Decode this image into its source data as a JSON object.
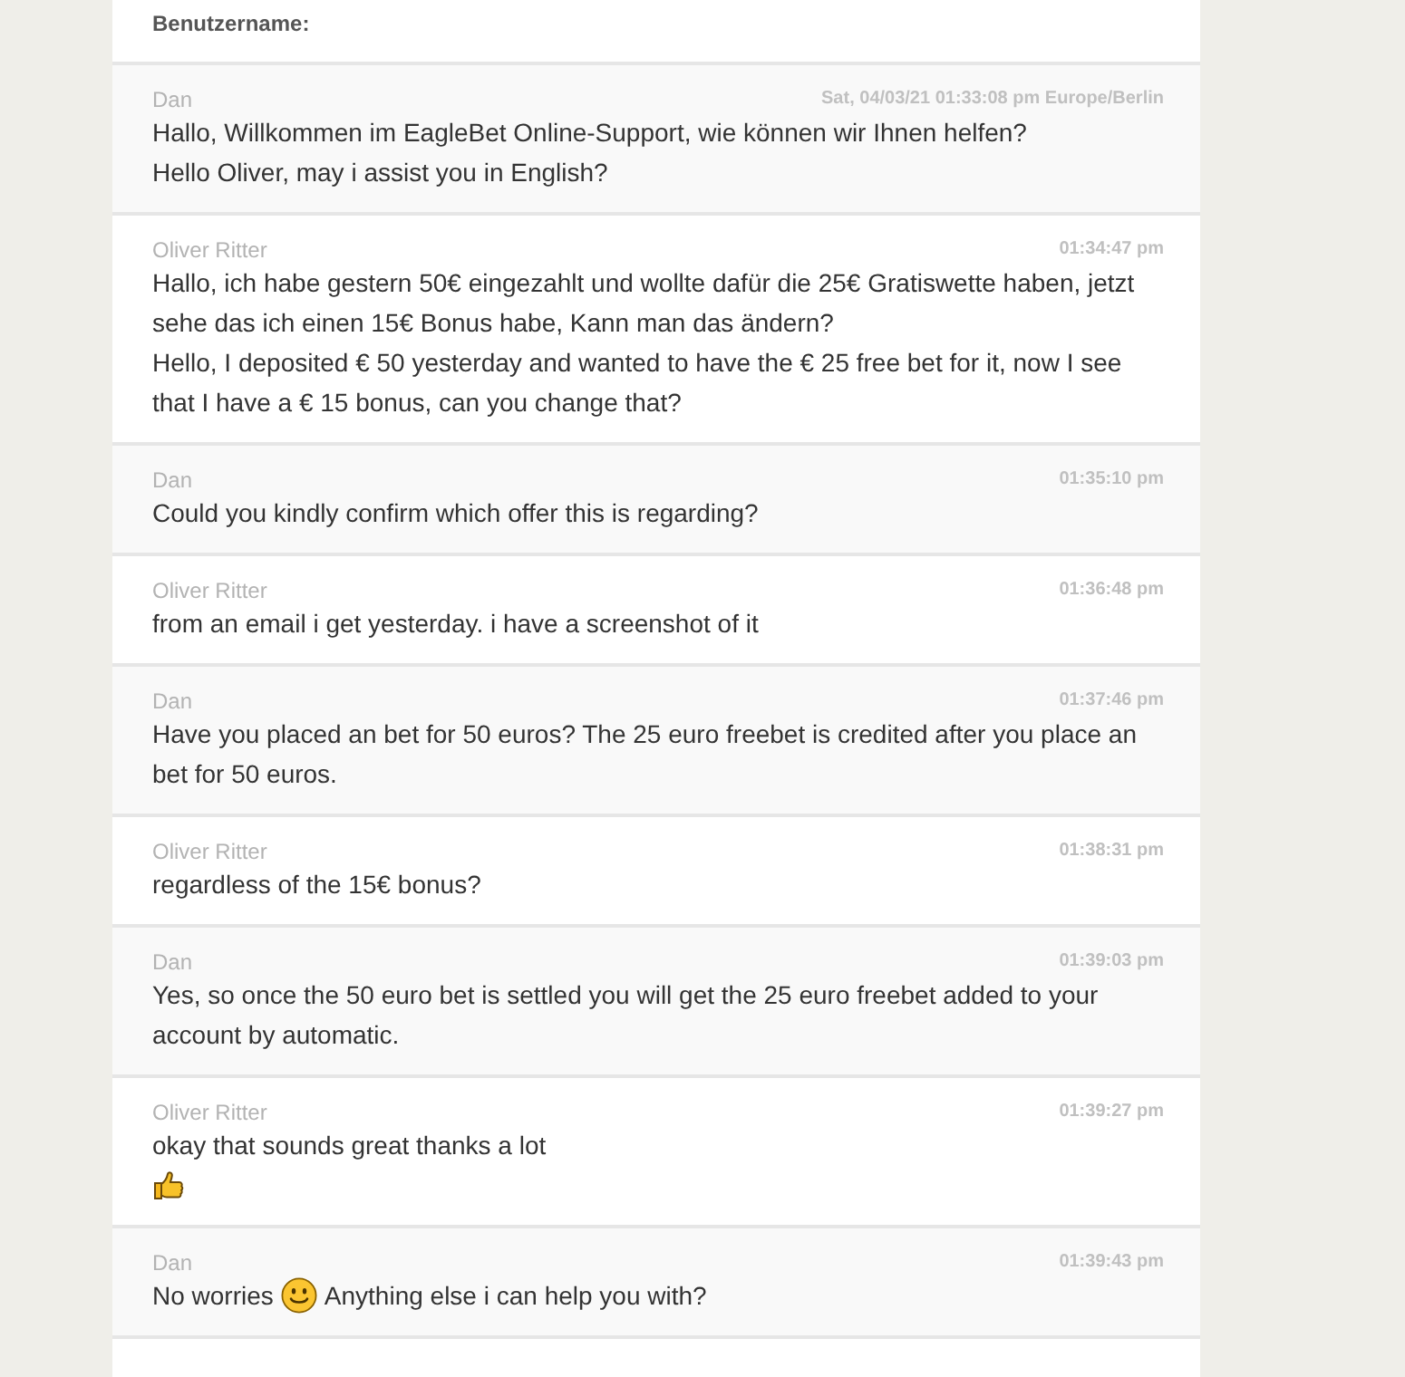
{
  "top_section": {
    "label": "Benutzername:"
  },
  "messages": [
    {
      "kind": "agent",
      "sender": "Dan",
      "time": "Sat, 04/03/21 01:33:08 pm Europe/Berlin",
      "paragraphs": [
        [
          {
            "kind": "text",
            "text": "Hallo, Willkommen im EagleBet Online-Support, wie können wir Ihnen helfen?"
          }
        ],
        [
          {
            "kind": "text",
            "text": "Hello Oliver, may i assist you in English?"
          }
        ]
      ]
    },
    {
      "kind": "customer",
      "sender": "Oliver Ritter",
      "time": "01:34:47 pm",
      "paragraphs": [
        [
          {
            "kind": "text",
            "text": "Hallo, ich habe gestern 50€ eingezahlt und wollte dafür die 25€ Gratiswette haben, jetzt sehe das ich einen 15€ Bonus habe, Kann man das ändern?"
          }
        ],
        [
          {
            "kind": "text",
            "text": "Hello, I deposited € 50 yesterday and wanted to have the € 25 free bet for it, now I see that I have a € 15 bonus, can you change that?"
          }
        ]
      ]
    },
    {
      "kind": "agent",
      "sender": "Dan",
      "time": "01:35:10 pm",
      "paragraphs": [
        [
          {
            "kind": "text",
            "text": "Could you kindly confirm which offer this is regarding?"
          }
        ]
      ]
    },
    {
      "kind": "customer",
      "sender": "Oliver Ritter",
      "time": "01:36:48 pm",
      "paragraphs": [
        [
          {
            "kind": "text",
            "text": "from an email i get yesterday. i have a screenshot of it"
          }
        ]
      ]
    },
    {
      "kind": "agent",
      "sender": "Dan",
      "time": "01:37:46 pm",
      "paragraphs": [
        [
          {
            "kind": "text",
            "text": "Have you placed an bet for 50 euros? The 25 euro freebet is credited after you place an bet for 50 euros."
          }
        ]
      ]
    },
    {
      "kind": "customer",
      "sender": "Oliver Ritter",
      "time": "01:38:31 pm",
      "paragraphs": [
        [
          {
            "kind": "text",
            "text": "regardless of the 15€ bonus?"
          }
        ]
      ]
    },
    {
      "kind": "agent",
      "sender": "Dan",
      "time": "01:39:03 pm",
      "paragraphs": [
        [
          {
            "kind": "text",
            "text": "Yes, so once the 50 euro bet is settled you will get the 25 euro freebet added to your account by automatic."
          }
        ]
      ]
    },
    {
      "kind": "customer",
      "sender": "Oliver Ritter",
      "time": "01:39:27 pm",
      "paragraphs": [
        [
          {
            "kind": "text",
            "text": "okay that sounds great thanks a lot"
          }
        ],
        [
          {
            "kind": "thumbs-up"
          }
        ]
      ]
    },
    {
      "kind": "agent",
      "sender": "Dan",
      "time": "01:39:43 pm",
      "paragraphs": [
        [
          {
            "kind": "text",
            "text": "No worries"
          },
          {
            "kind": "smiley"
          },
          {
            "kind": "text",
            "text": "Anything else i can help you with?"
          }
        ]
      ]
    }
  ]
}
